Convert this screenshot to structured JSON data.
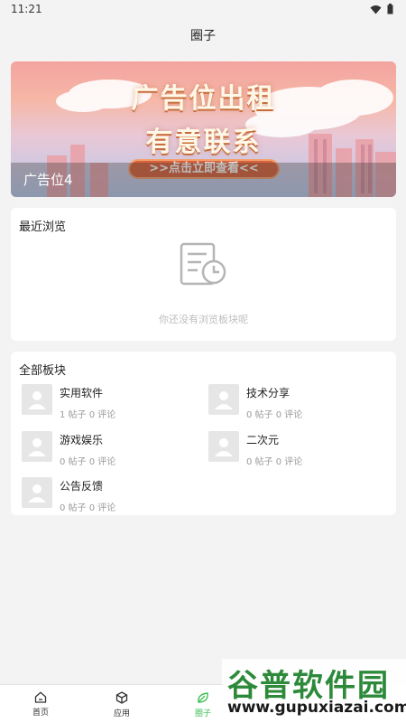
{
  "status_bar": {
    "time": "11:21"
  },
  "header": {
    "title": "圈子"
  },
  "banner": {
    "headline_line1": "广告位出租",
    "headline_line2": "有意联系",
    "cta": ">>点击立即查看<<",
    "caption": "广告位4"
  },
  "recent": {
    "title": "最近浏览",
    "empty_text": "你还没有浏览板块呢"
  },
  "all_boards": {
    "title": "全部板块",
    "items": [
      {
        "name": "实用软件",
        "stats": "1 帖子 0 评论"
      },
      {
        "name": "技术分享",
        "stats": "0 帖子 0 评论"
      },
      {
        "name": "游戏娱乐",
        "stats": "0 帖子 0 评论"
      },
      {
        "name": "二次元",
        "stats": "0 帖子 0 评论"
      },
      {
        "name": "公告反馈",
        "stats": "0 帖子 0 评论"
      }
    ]
  },
  "bottom_nav": {
    "tabs": [
      {
        "label": "首页",
        "icon": "home-icon"
      },
      {
        "label": "应用",
        "icon": "cube-icon"
      },
      {
        "label": "圈子",
        "icon": "leaf-icon",
        "active": true
      }
    ]
  },
  "watermark": {
    "title": "谷普软件园",
    "url": "www.gupuxiazai.com"
  },
  "colors": {
    "accent": "#3bbf52",
    "background": "#f3f3f3"
  }
}
